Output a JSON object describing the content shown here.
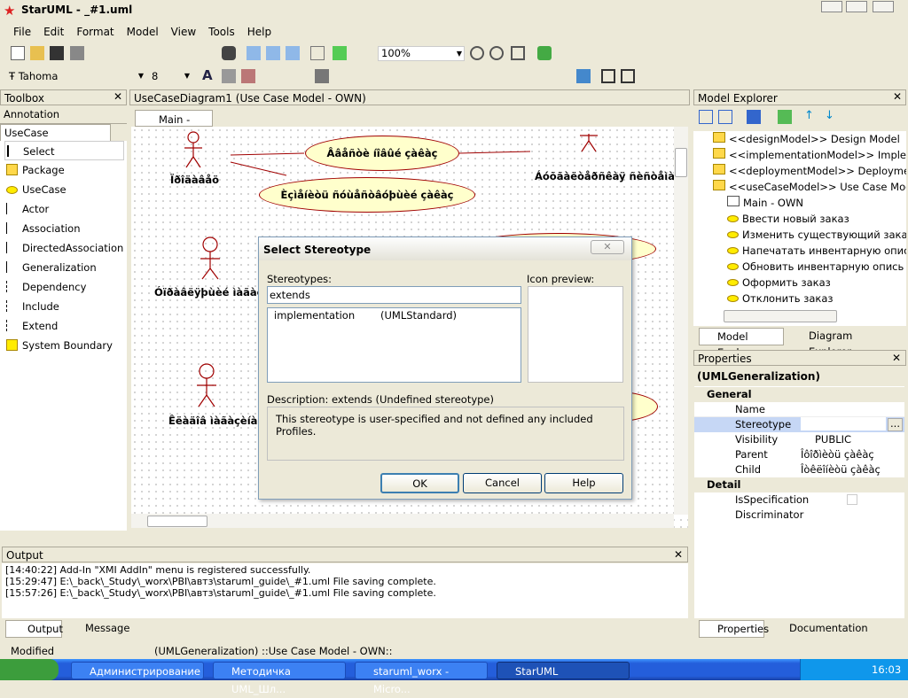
{
  "window": {
    "title": "StarUML - _#1.uml"
  },
  "menu": [
    "File",
    "Edit",
    "Format",
    "Model",
    "View",
    "Tools",
    "Help"
  ],
  "toolbar": {
    "zoom": "100%",
    "font": "Tahoma",
    "size": "8"
  },
  "toolbox": {
    "title": "Toolbox",
    "annotation": "Annotation",
    "usecase": "UseCase",
    "items": [
      "Select",
      "Package",
      "UseCase",
      "Actor",
      "Association",
      "DirectedAssociation",
      "Generalization",
      "Dependency",
      "Include",
      "Extend",
      "System Boundary"
    ]
  },
  "diagram": {
    "title": "UseCaseDiagram1 (Use Case Model - OWN)",
    "tab": "Main - OWN",
    "usecases": [
      "Ââåñòè íîâûé çàêàç",
      "Èçìåíèòü ñóùåñòâóþùèé çàêàç"
    ],
    "actors": [
      "Ïðîäàâåö",
      "Áóõãàëòåðñêàÿ ñèñòåìà",
      "Óïðàâëÿþùèé ìàãàçèíà",
      "Êëàäîâ ìàãàçèíà"
    ]
  },
  "explorer": {
    "title": "Model Explorer",
    "items": [
      "<<designModel>> Design Model",
      "<<implementationModel>> Implementation Model",
      "<<deploymentModel>> Deployment Model",
      "<<useCaseModel>> Use Case Model",
      "Main - OWN",
      "Ввести новый заказ",
      "Изменить существующий заказ",
      "Напечатать инвентарную опись",
      "Обновить инвентарную опись",
      "Оформить заказ",
      "Отклонить заказ"
    ],
    "tabs": [
      "Model Explorer",
      "Diagram Explorer"
    ]
  },
  "properties": {
    "title": "Properties",
    "type": "(UMLGeneralization)",
    "general": "General",
    "detail": "Detail",
    "rows": [
      {
        "name": "Name",
        "value": ""
      },
      {
        "name": "Stereotype",
        "value": ""
      },
      {
        "name": "Visibility",
        "value": "PUBLIC"
      },
      {
        "name": "Parent",
        "value": "Îôîðìèòü çàêàç"
      },
      {
        "name": "Child",
        "value": "Îòêëîíèòü çàêàç"
      }
    ],
    "detail_rows": [
      {
        "name": "IsSpecification",
        "value": ""
      },
      {
        "name": "Discriminator",
        "value": ""
      }
    ],
    "tabs": [
      "Properties",
      "Documentation"
    ]
  },
  "dialog": {
    "title": "Select Stereotype",
    "stereotypes_label": "Stereotypes:",
    "input": "extends",
    "icon_label": "Icon preview:",
    "list": [
      {
        "name": "implementation",
        "profile": "(UMLStandard)"
      }
    ],
    "desc_label": "Description: extends (Undefined stereotype)",
    "desc": "This stereotype is user-specified and not defined any included Profiles.",
    "ok": "OK",
    "cancel": "Cancel",
    "help": "Help"
  },
  "output": {
    "title": "Output",
    "lines": [
      "[14:40:22]  Add-In \"XMI AddIn\" menu is registered successfully.",
      "[15:29:47]  E:\\_back\\_Study\\_worx\\PBI\\aвтз\\staruml_guide\\_#1.uml File saving complete.",
      "[15:57:26]  E:\\_back\\_Study\\_worx\\PBI\\aвтз\\staruml_guide\\_#1.uml File saving complete."
    ],
    "tabs": [
      "Output",
      "Message"
    ]
  },
  "status": {
    "left": "Modified",
    "main": "(UMLGeneralization) ::Use Case Model - OWN::"
  },
  "taskbar": {
    "items": [
      "Администрирование",
      "Методичка UML_Шл...",
      "staruml_worx - Micro...",
      "StarUML"
    ],
    "clock": "16:03"
  }
}
